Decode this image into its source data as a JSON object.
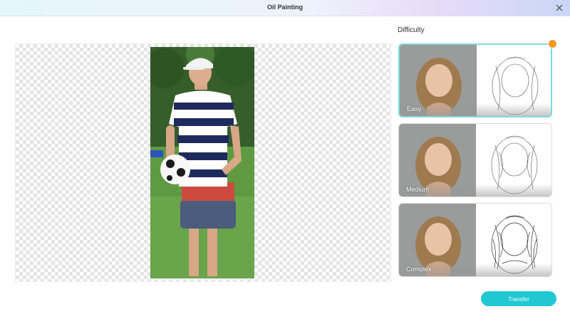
{
  "header": {
    "title": "Oil Painting",
    "close_icon": "close-icon"
  },
  "difficulty": {
    "title": "Difficulty",
    "options": [
      {
        "label": "Easy",
        "selected": true,
        "badge_icon": "crown-icon"
      },
      {
        "label": "Medium",
        "selected": false
      },
      {
        "label": "Complex",
        "selected": false
      }
    ]
  },
  "actions": {
    "transfer_label": "Transfer"
  },
  "colors": {
    "accent": "#1fc8d3",
    "selected_border": "#7fd9df",
    "badge": "#f59a23"
  }
}
